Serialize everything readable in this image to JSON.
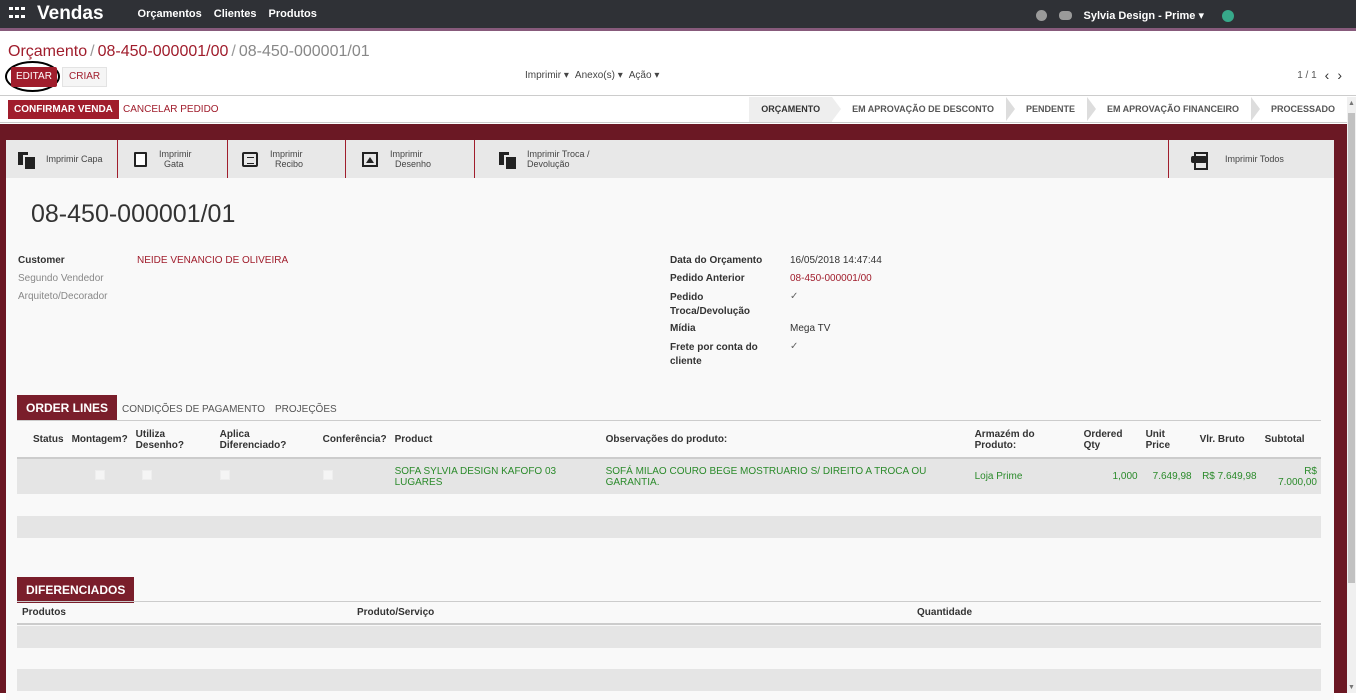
{
  "topbar": {
    "app_name": "Vendas",
    "menu": [
      "Orçamentos",
      "Clientes",
      "Produtos"
    ],
    "user": "Sylvia Design - Prime"
  },
  "breadcrumb": {
    "root": "Orçamento",
    "parent": "08-450-000001/00",
    "current": "08-450-000001/01"
  },
  "buttons": {
    "edit": "EDITAR",
    "create": "CRIAR",
    "print": "Imprimir",
    "attachments": "Anexo(s)",
    "action": "Ação",
    "confirm_sale": "CONFIRMAR VENDA",
    "cancel_order": "CANCELAR PEDIDO"
  },
  "pager": {
    "value": "1 / 1"
  },
  "statusbar": [
    "ORÇAMENTO",
    "EM APROVAÇÃO DE DESCONTO",
    "PENDENTE",
    "EM APROVAÇÃO FINANCEIRO",
    "PROCESSADO"
  ],
  "print_buttons": {
    "capa": "Imprimir Capa",
    "gata_1": "Imprimir",
    "gata_2": "Gata",
    "recibo_1": "Imprimir",
    "recibo_2": "Recibo",
    "desenho_1": "Imprimir",
    "desenho_2": "Desenho",
    "troca_1": "Imprimir Troca /",
    "troca_2": "Devolução",
    "todos": "Imprimir Todos"
  },
  "record": {
    "title": "08-450-000001/01",
    "customer_label": "Customer",
    "customer": "NEIDE VENANCIO DE OLIVEIRA",
    "segundo_vendedor_label": "Segundo Vendedor",
    "arquiteto_label": "Arquiteto/Decorador",
    "data_label": "Data do Orçamento",
    "data": "16/05/2018 14:47:44",
    "pedido_anterior_label": "Pedido Anterior",
    "pedido_anterior": "08-450-000001/00",
    "troca_label_1": "Pedido",
    "troca_label_2": "Troca/Devolução",
    "midia_label": "Mídia",
    "midia": "Mega TV",
    "frete_label_1": "Frete por conta do",
    "frete_label_2": "cliente"
  },
  "tabs": [
    "ORDER LINES",
    "CONDIÇÕES DE PAGAMENTO",
    "PROJEÇÕES"
  ],
  "order_lines": {
    "headers": {
      "status": "Status",
      "montagem": "Montagem?",
      "utiliza_1": "Utiliza",
      "utiliza_2": "Desenho?",
      "aplica_1": "Aplica",
      "aplica_2": "Diferenciado?",
      "conferencia": "Conferência?",
      "product": "Product",
      "obs": "Observações do produto:",
      "armazem_1": "Armazém do",
      "armazem_2": "Produto:",
      "ordered_1": "Ordered",
      "ordered_2": "Qty",
      "unit_1": "Unit",
      "unit_2": "Price",
      "bruto": "Vlr. Bruto",
      "subtotal": "Subtotal"
    },
    "row": {
      "product_1": "SOFA SYLVIA DESIGN KAFOFO 03",
      "product_2": "LUGARES",
      "obs_1": "SOFÁ MILAO COURO BEGE MOSTRUARIO S/ DIREITO A TROCA OU",
      "obs_2": "GARANTIA.",
      "armazem": "Loja Prime",
      "qty": "1,000",
      "unit_price": "7.649,98",
      "bruto": "R$ 7.649,98",
      "subtotal": "R$ 7.000,00"
    }
  },
  "diferenciados": {
    "tab": "DIFERENCIADOS",
    "headers": [
      "Produtos",
      "Produto/Serviço",
      "Quantidade"
    ]
  }
}
